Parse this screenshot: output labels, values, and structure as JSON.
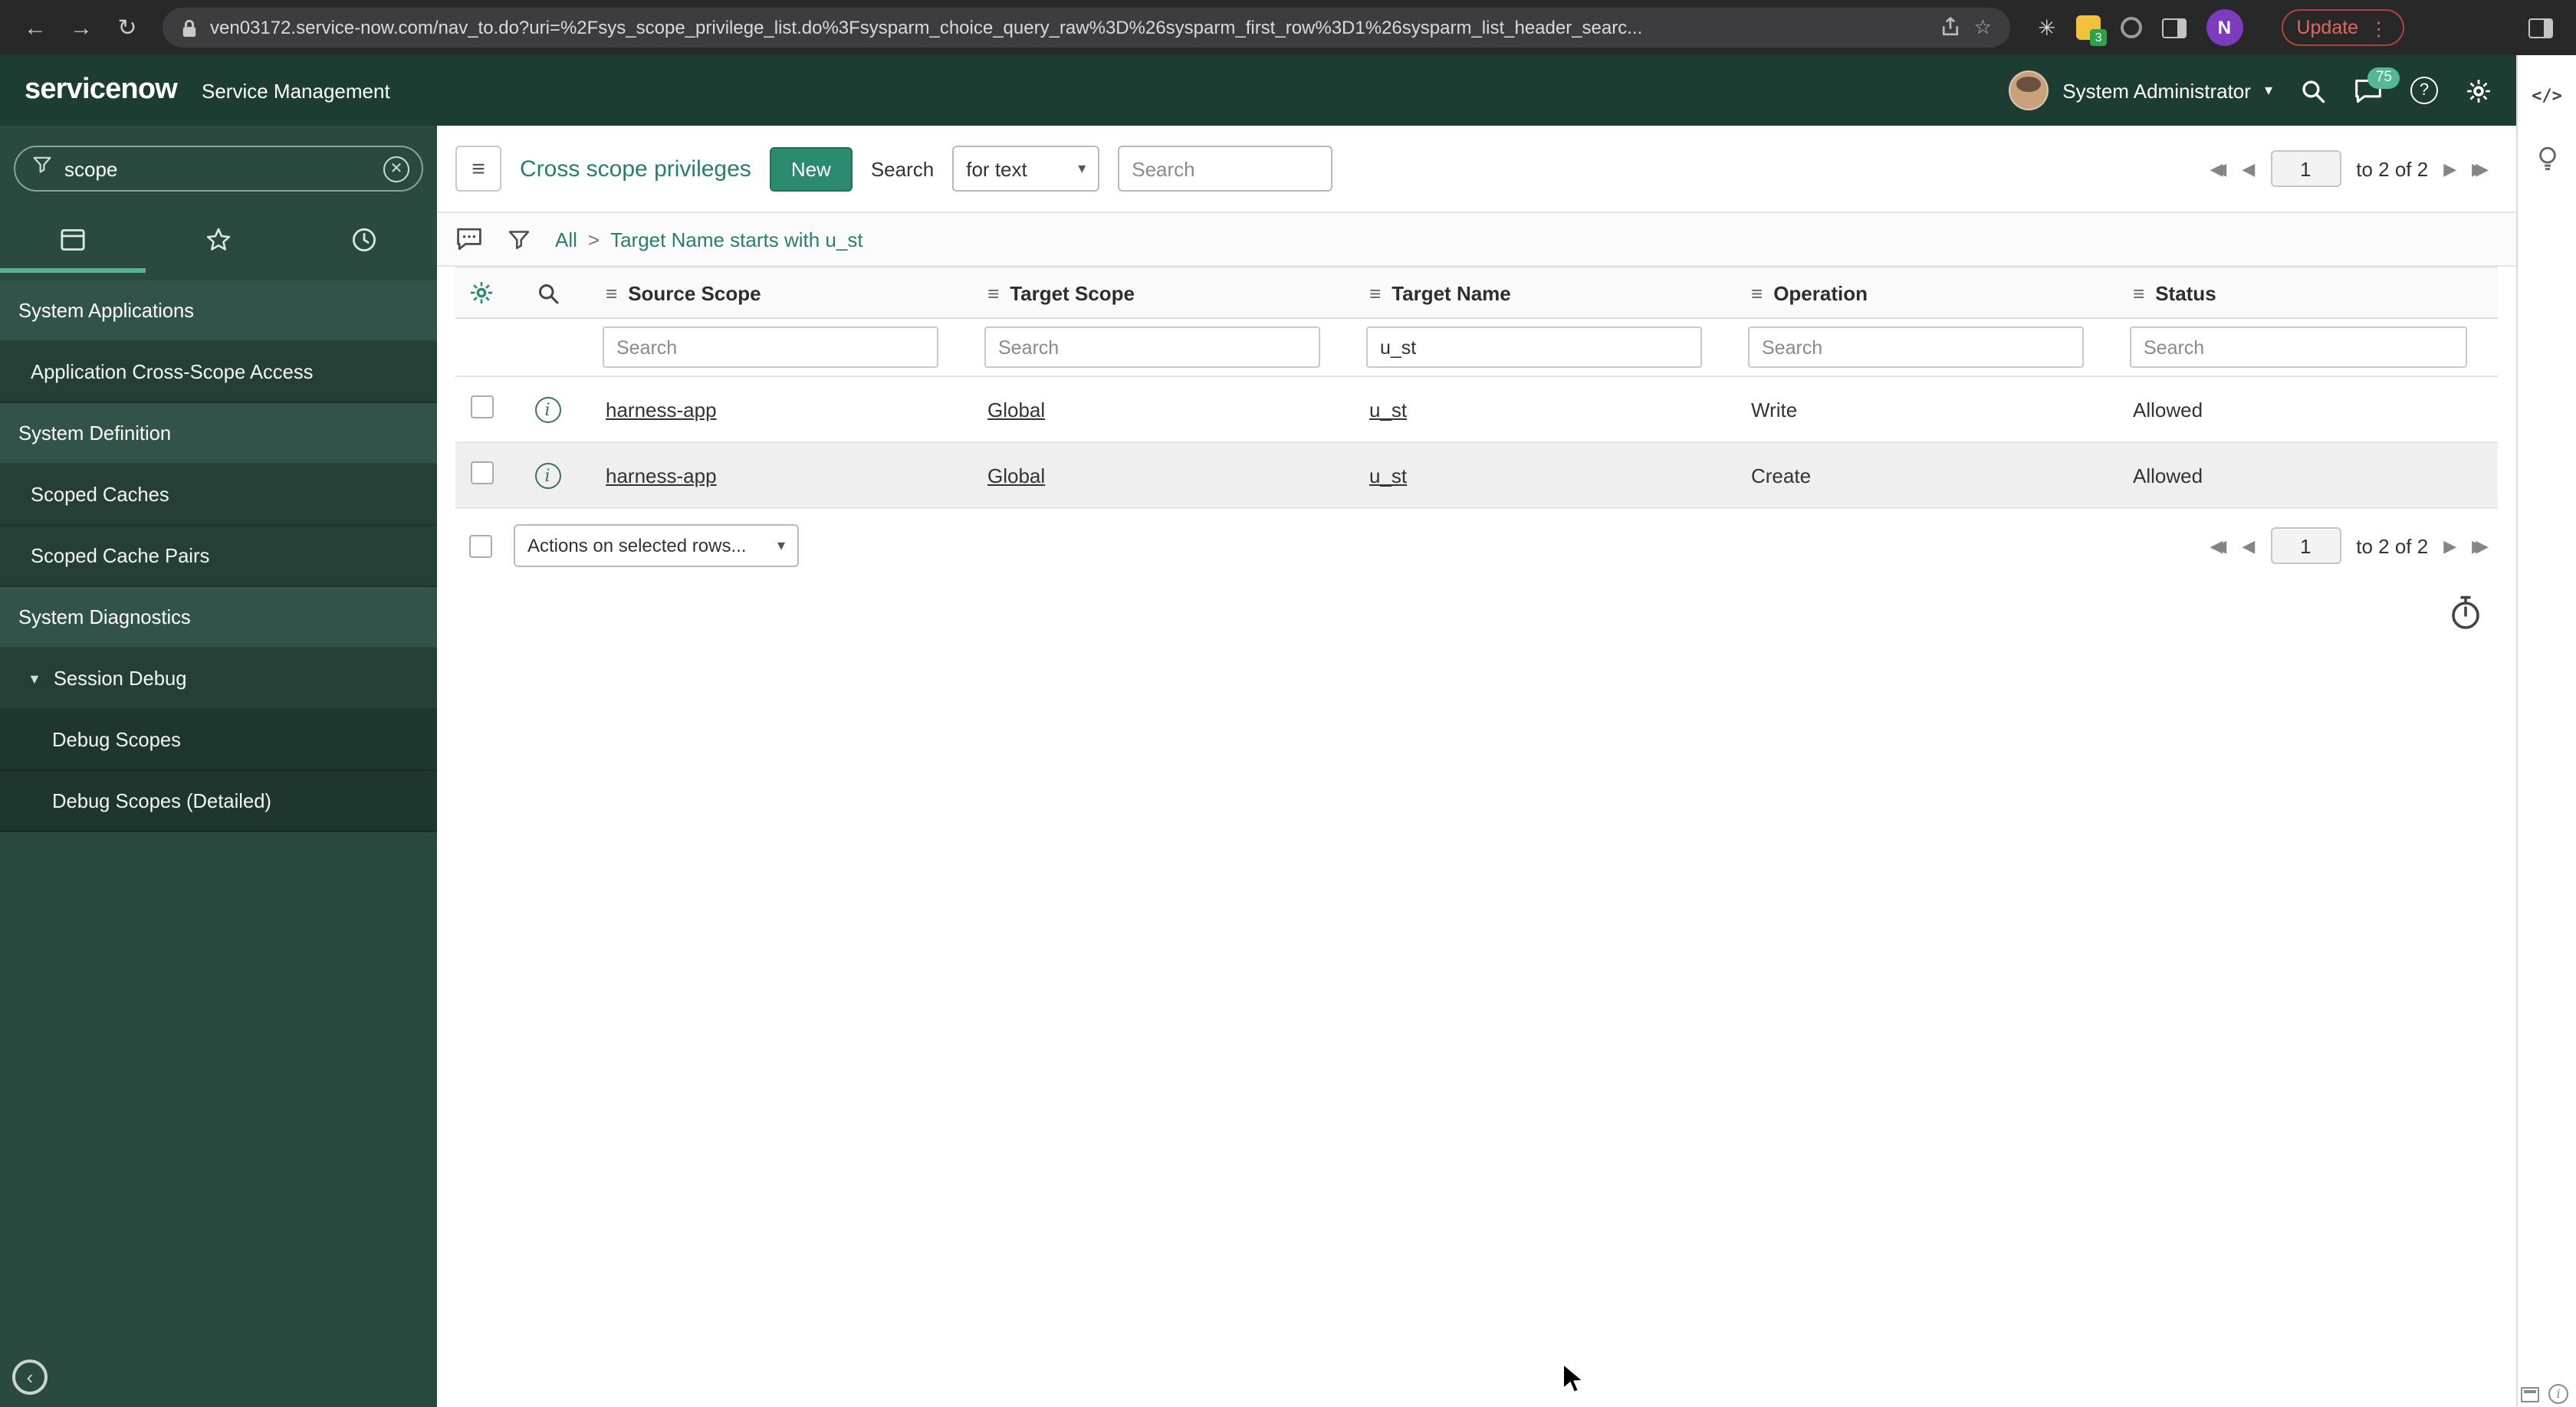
{
  "browser": {
    "url": "ven03172.service-now.com/nav_to.do?uri=%2Fsys_scope_privilege_list.do%3Fsysparm_choice_query_raw%3D%26sysparm_first_row%3D1%26sysparm_list_header_searc...",
    "update_label": "Update",
    "avatar_letter": "N",
    "extension_badge": "3"
  },
  "app_header": {
    "logo": "servicenow",
    "product": "Service Management",
    "user_name": "System Administrator",
    "notification_count": "75"
  },
  "sidebar": {
    "search_value": "scope",
    "items": [
      {
        "label": "System Applications"
      },
      {
        "label": "Application Cross-Scope Access"
      },
      {
        "label": "System Definition"
      },
      {
        "label": "Scoped Caches"
      },
      {
        "label": "Scoped Cache Pairs"
      },
      {
        "label": "System Diagnostics"
      },
      {
        "label": "Session Debug",
        "expander": "▼"
      },
      {
        "label": "Debug Scopes"
      },
      {
        "label": "Debug Scopes (Detailed)"
      }
    ]
  },
  "list": {
    "title": "Cross scope privileges",
    "new_button": "New",
    "search_label": "Search",
    "search_type": "for text",
    "search_placeholder": "Search",
    "breadcrumb_all": "All",
    "breadcrumb_sep": ">",
    "breadcrumb_filter": "Target Name starts with u_st",
    "columns": [
      "Source Scope",
      "Target Scope",
      "Target Name",
      "Operation",
      "Status"
    ],
    "filter_placeholder": "Search",
    "target_name_filter": "u_st",
    "rows": [
      {
        "source_scope": "harness-app",
        "target_scope": "Global",
        "target_name": "u_st",
        "operation": "Write",
        "status": "Allowed"
      },
      {
        "source_scope": "harness-app",
        "target_scope": "Global",
        "target_name": "u_st",
        "operation": "Create",
        "status": "Allowed"
      }
    ],
    "actions_placeholder": "Actions on selected rows...",
    "pagination": {
      "page": "1",
      "range": "to 2 of 2"
    }
  },
  "colors": {
    "accent_teal": "#2b8a6f",
    "header_green": "#1d3c32",
    "sidebar_green": "#2a4a40",
    "badge_teal": "#54b894",
    "update_red": "#e3675c"
  }
}
